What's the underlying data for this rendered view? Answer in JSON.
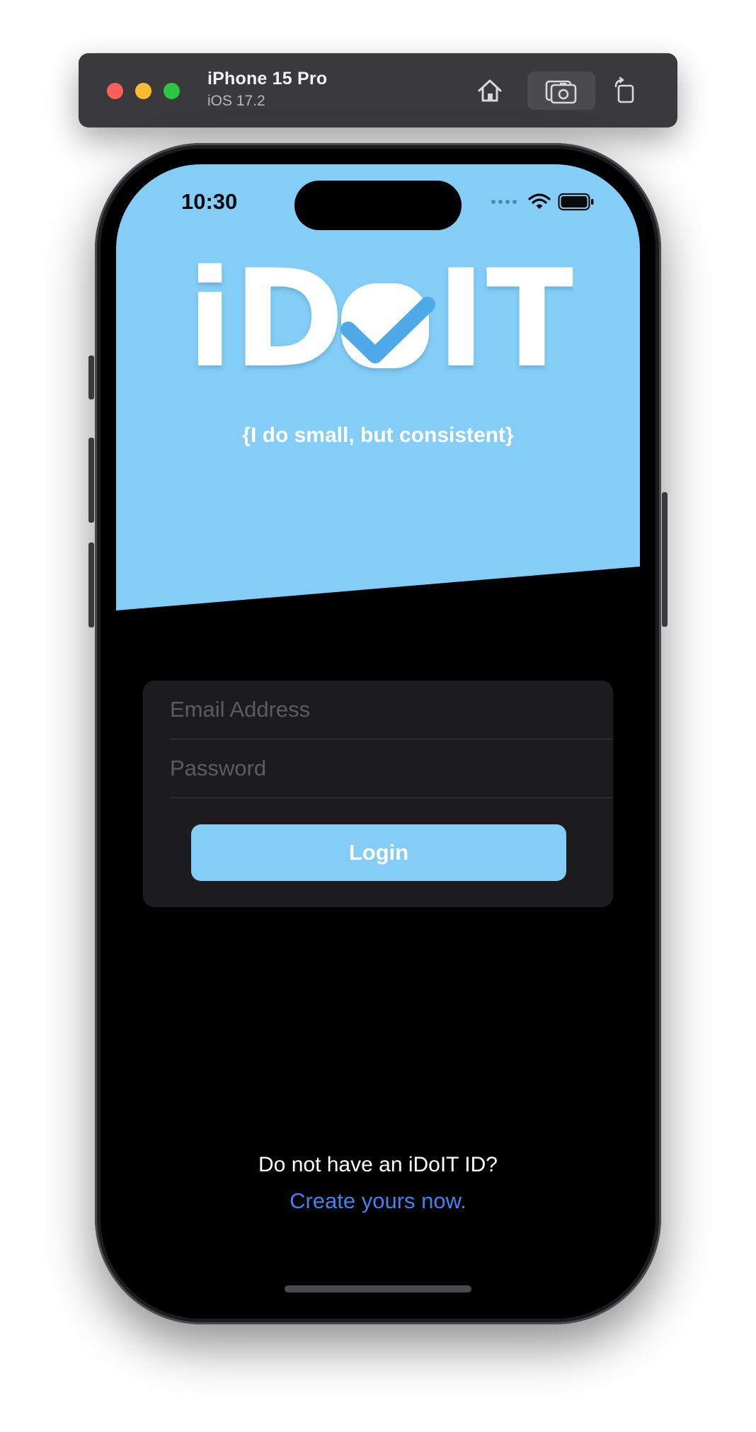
{
  "simulator": {
    "device_name": "iPhone 15 Pro",
    "os_version": "iOS 17.2",
    "buttons": {
      "home_icon": "home-icon",
      "screenshot_icon": "screenshot-icon",
      "rotate_icon": "rotate-icon"
    }
  },
  "status_bar": {
    "time": "10:30"
  },
  "hero": {
    "logo_text_left": "iD",
    "logo_text_right": "IT",
    "tagline": "{I do small, but consistent}"
  },
  "login_form": {
    "email_placeholder": "Email Address",
    "email_value": "",
    "password_placeholder": "Password",
    "password_value": "",
    "login_label": "Login"
  },
  "footer": {
    "prompt": "Do not have an iDoIT ID?",
    "link": "Create yours now."
  },
  "colors": {
    "accent_blue": "#83cdf7",
    "link_blue": "#3f82f0",
    "checkmark_blue": "#4ea9e8",
    "card_bg": "#1c1c1e"
  }
}
